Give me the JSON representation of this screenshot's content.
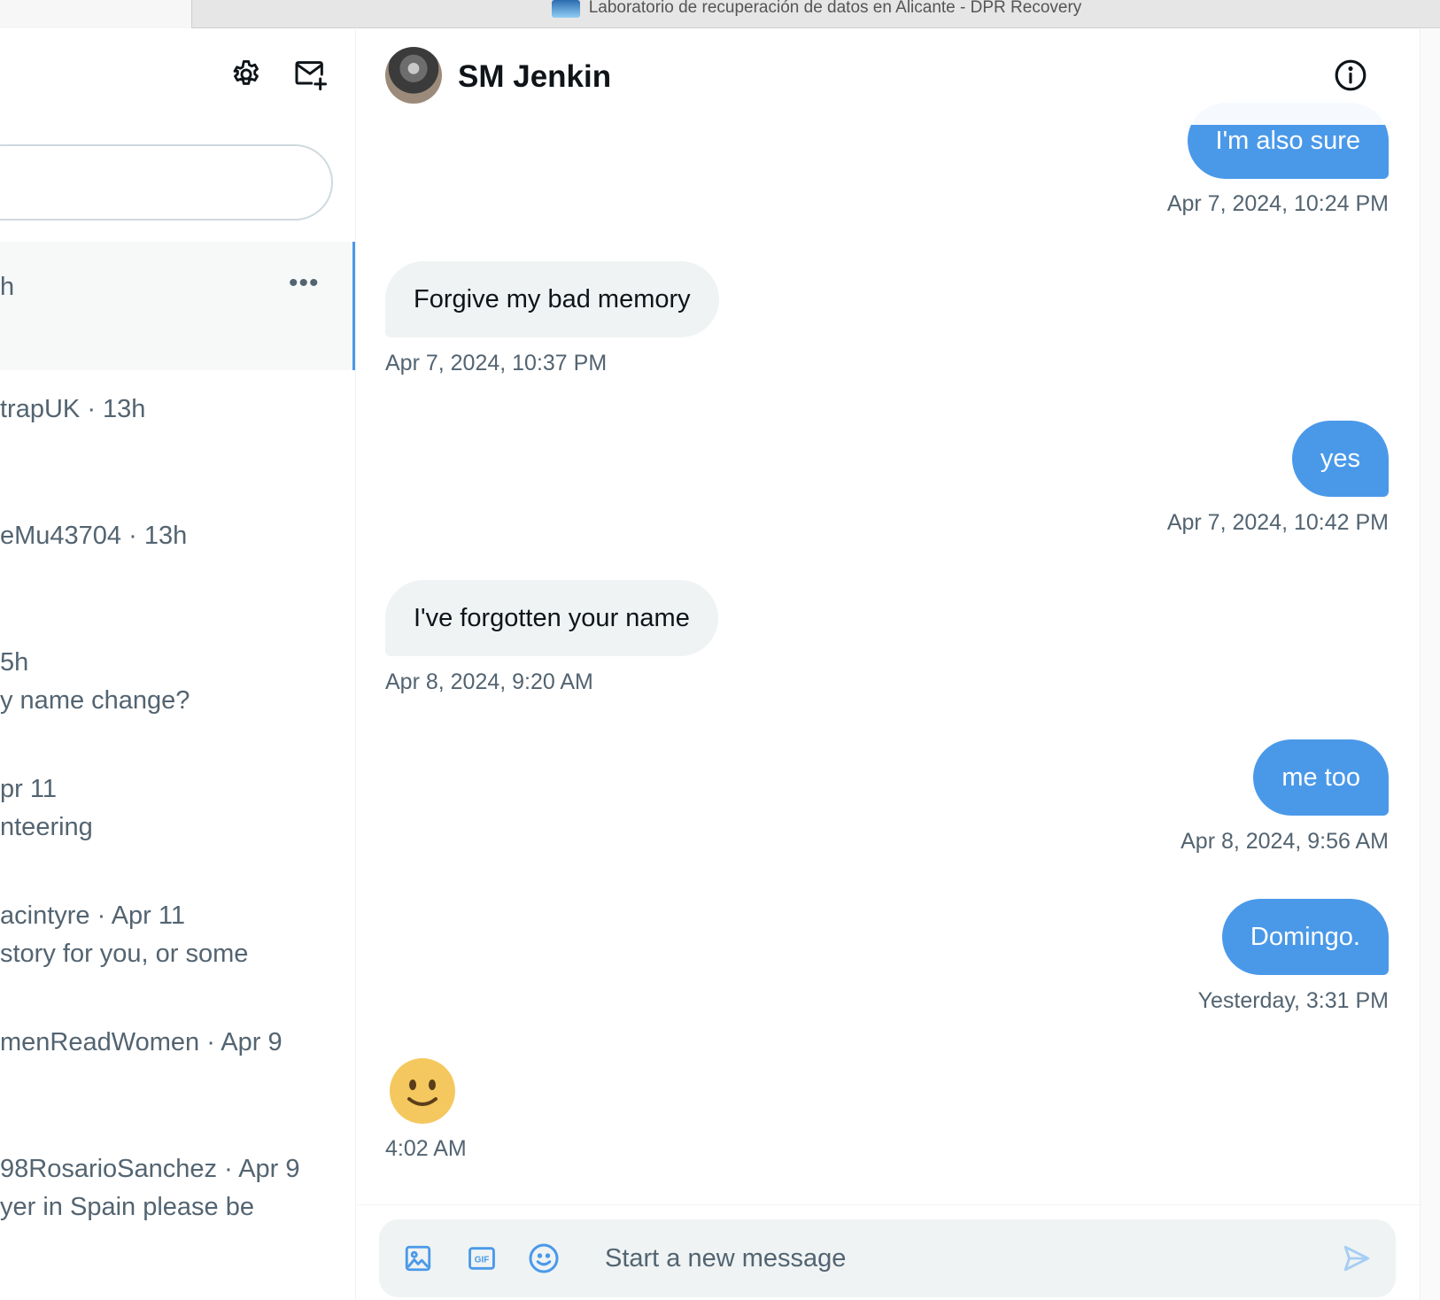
{
  "browser": {
    "active_tab_title": "Laboratorio de recuperación de datos en Alicante - DPR Recovery",
    "favicon": "dpr-recovery-favicon"
  },
  "sidebar": {
    "settings_icon": "gear-icon",
    "new_message_icon": "mail-plus-icon",
    "more_icon": "more-horizontal-icon",
    "conversations": [
      {
        "line1": "h",
        "line2": "",
        "active": true
      },
      {
        "line1": "trapUK · 13h",
        "line2": ""
      },
      {
        "line1": "eMu43704 · 13h",
        "line2": ""
      },
      {
        "line1": "5h",
        "line2": "y name change?"
      },
      {
        "line1": "pr 11",
        "line2": "nteering"
      },
      {
        "line1": "acintyre · Apr 11",
        "line2": "story for you, or some"
      },
      {
        "line1": "menReadWomen · Apr 9",
        "line2": ""
      },
      {
        "line1": "98RosarioSanchez · Apr 9",
        "line2": "yer in Spain please be"
      }
    ]
  },
  "chat": {
    "contact_name": "SM Jenkin",
    "info_icon": "info-icon",
    "messages": [
      {
        "text": "I'm also sure",
        "time": "Apr 7, 2024, 10:24 PM",
        "direction": "out"
      },
      {
        "text": "Forgive my bad memory",
        "time": "Apr 7, 2024, 10:37 PM",
        "direction": "in"
      },
      {
        "text": "yes",
        "time": "Apr 7, 2024, 10:42 PM",
        "direction": "out"
      },
      {
        "text": "I've forgotten your name",
        "time": "Apr 8, 2024, 9:20 AM",
        "direction": "in"
      },
      {
        "text": "me too",
        "time": "Apr 8, 2024, 9:56 AM",
        "direction": "out"
      },
      {
        "text": "Domingo.",
        "time": "Yesterday, 3:31 PM",
        "direction": "out"
      },
      {
        "text": "",
        "emoji": "slightly-smiling-face",
        "time": "4:02 AM",
        "direction": "in"
      }
    ]
  },
  "composer": {
    "placeholder": "Start a new message",
    "media_icon": "image-icon",
    "gif_icon": "gif-icon",
    "emoji_icon": "emoji-icon",
    "send_icon": "send-icon"
  },
  "colors": {
    "accent": "#4a99e9",
    "incoming_bubble": "#eff3f4",
    "secondary_text": "#536471"
  }
}
